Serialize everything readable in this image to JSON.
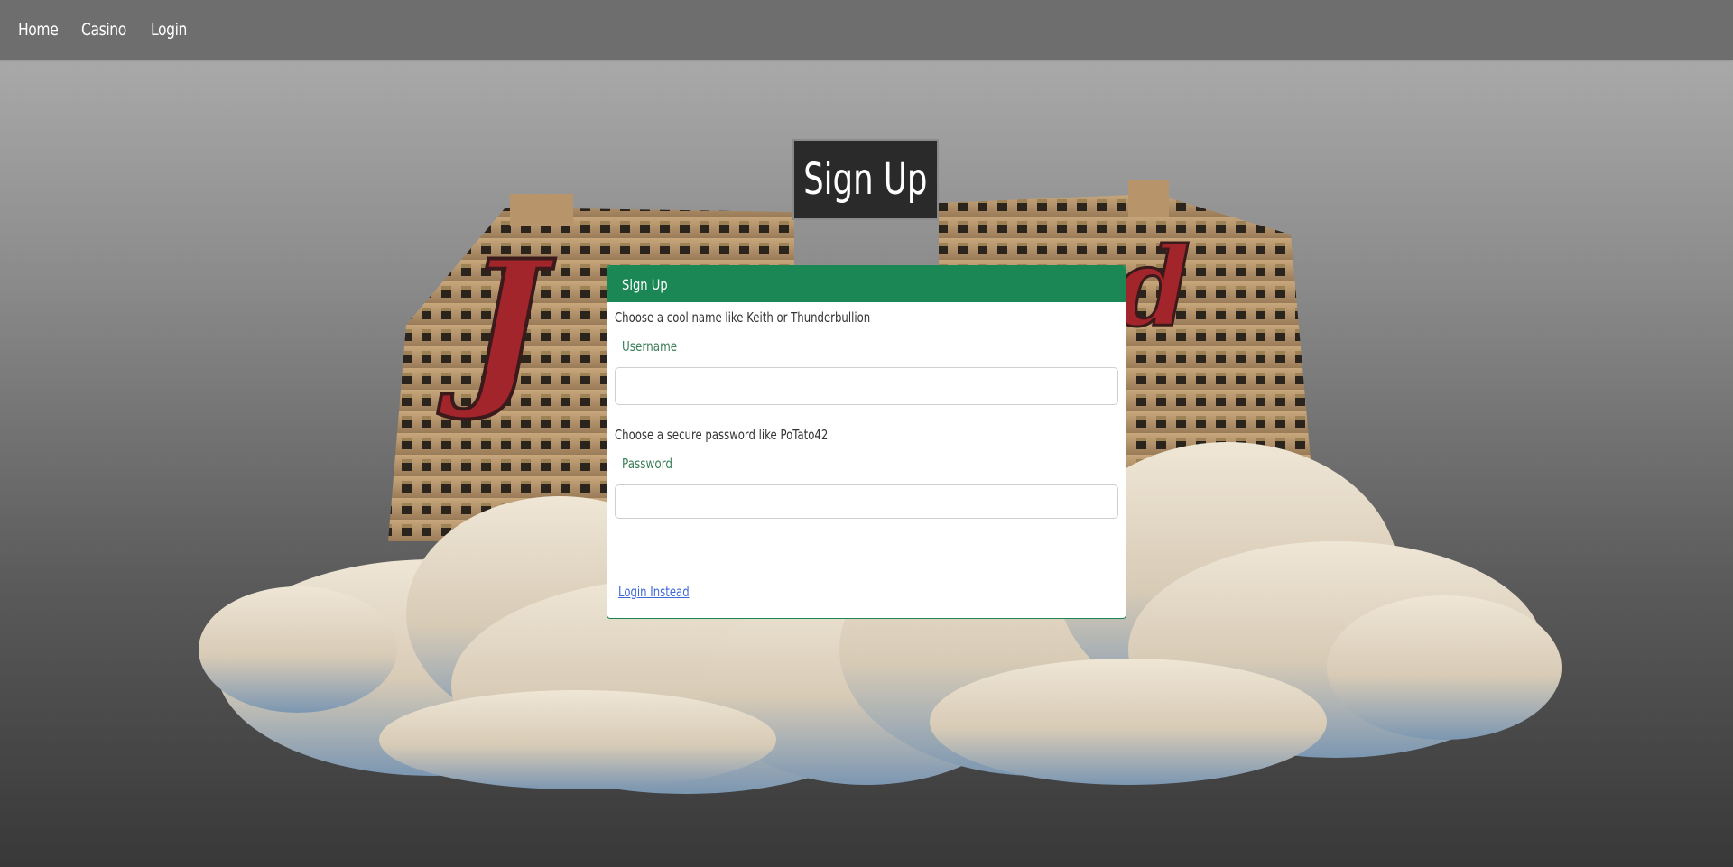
{
  "nav": {
    "items": [
      {
        "label": "Home"
      },
      {
        "label": "Casino"
      },
      {
        "label": "Login"
      }
    ]
  },
  "hero": {
    "title": "Sign Up",
    "logo_text": "Jackpot Island"
  },
  "form": {
    "header": "Sign Up",
    "username_hint": "Choose a cool name like Keith or Thunderbullion",
    "username_label": "Username",
    "username_value": "",
    "password_hint": "Choose a secure password like PoTato42",
    "password_label": "Password",
    "password_value": "",
    "login_link": "Login Instead"
  },
  "colors": {
    "accent": "#1a8754",
    "link": "#3d68d8",
    "logo": "#a1252a"
  }
}
